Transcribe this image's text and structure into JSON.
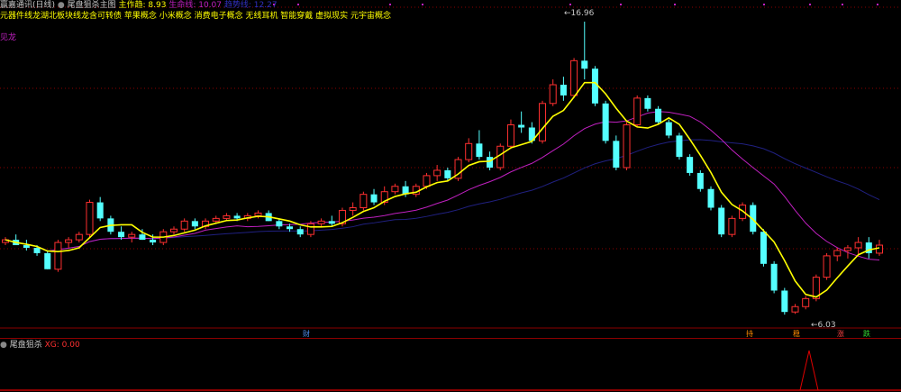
{
  "header": {
    "stock_name": "赢嘉通讯(日线)",
    "indicator_name": "尾盘狙杀主图",
    "ma_label": "主作趋: 8.93",
    "line2_label": "生命线: 10.07",
    "line3_label": "趋势线: 12.27"
  },
  "concepts_text": "元器件线龙湖北板块线龙含可转债 苹果概念 小米概念 消费电子概念 无线耳机 智能穿戴 虚拟现实 元宇宙概念",
  "side_label": "见龙",
  "price_high_label": "16.96",
  "price_low_label": "6.03",
  "bottom_markers": [
    {
      "text": "财",
      "color": "#4f8ff0"
    },
    {
      "text": "持",
      "color": "#ff8c00"
    },
    {
      "text": "稳",
      "color": "#ff8c00"
    },
    {
      "text": "涨",
      "color": "#ff4444"
    },
    {
      "text": "跌",
      "color": "#33dd33"
    }
  ],
  "sub_panel": {
    "title": "尾盘狙杀",
    "value_label": "XG: 0.00"
  },
  "colors": {
    "up": "#ff3030",
    "down": "#54ffff",
    "ma_yellow": "#ffff00",
    "ma_purple": "#c020c0",
    "ma_navy": "#202080",
    "dotted_grid": "#9a0000"
  },
  "chart_data": {
    "type": "candlestick",
    "ylim": [
      5.5,
      17.5
    ],
    "candles": [
      [
        8.7,
        8.9,
        8.6,
        8.8
      ],
      [
        8.8,
        9.0,
        8.7,
        8.6
      ],
      [
        8.6,
        8.8,
        8.4,
        8.5
      ],
      [
        8.5,
        8.6,
        8.2,
        8.3
      ],
      [
        8.3,
        8.4,
        7.7,
        7.7
      ],
      [
        7.7,
        8.8,
        7.6,
        8.7
      ],
      [
        8.7,
        8.9,
        8.5,
        8.8
      ],
      [
        8.8,
        9.1,
        8.7,
        9.0
      ],
      [
        9.0,
        10.3,
        8.9,
        10.2
      ],
      [
        10.2,
        10.4,
        9.5,
        9.6
      ],
      [
        9.6,
        9.7,
        9.0,
        9.1
      ],
      [
        9.1,
        9.3,
        8.8,
        8.9
      ],
      [
        8.9,
        9.1,
        8.7,
        9.0
      ],
      [
        9.0,
        9.2,
        8.8,
        8.8
      ],
      [
        8.8,
        9.0,
        8.6,
        8.7
      ],
      [
        8.7,
        9.2,
        8.6,
        9.1
      ],
      [
        9.1,
        9.3,
        9.0,
        9.2
      ],
      [
        9.2,
        9.6,
        9.1,
        9.5
      ],
      [
        9.5,
        9.6,
        9.2,
        9.3
      ],
      [
        9.3,
        9.6,
        9.2,
        9.5
      ],
      [
        9.5,
        9.7,
        9.4,
        9.6
      ],
      [
        9.6,
        9.8,
        9.5,
        9.7
      ],
      [
        9.7,
        9.8,
        9.5,
        9.6
      ],
      [
        9.6,
        9.8,
        9.5,
        9.7
      ],
      [
        9.7,
        9.9,
        9.6,
        9.8
      ],
      [
        9.8,
        9.9,
        9.5,
        9.5
      ],
      [
        9.5,
        9.6,
        9.2,
        9.3
      ],
      [
        9.3,
        9.4,
        9.1,
        9.2
      ],
      [
        9.2,
        9.3,
        8.9,
        9.0
      ],
      [
        9.0,
        9.5,
        8.9,
        9.4
      ],
      [
        9.4,
        9.6,
        9.3,
        9.5
      ],
      [
        9.5,
        9.7,
        9.3,
        9.4
      ],
      [
        9.4,
        10.0,
        9.3,
        9.9
      ],
      [
        9.9,
        10.2,
        9.7,
        10.0
      ],
      [
        10.0,
        10.6,
        9.9,
        10.5
      ],
      [
        10.5,
        10.7,
        10.1,
        10.2
      ],
      [
        10.2,
        10.8,
        10.1,
        10.6
      ],
      [
        10.6,
        10.9,
        10.5,
        10.8
      ],
      [
        10.8,
        11.0,
        10.4,
        10.5
      ],
      [
        10.5,
        10.9,
        10.4,
        10.8
      ],
      [
        10.8,
        11.3,
        10.7,
        11.2
      ],
      [
        11.2,
        11.6,
        11.0,
        11.4
      ],
      [
        11.4,
        11.5,
        11.0,
        11.1
      ],
      [
        11.1,
        11.9,
        11.0,
        11.8
      ],
      [
        11.8,
        12.6,
        11.7,
        12.4
      ],
      [
        12.4,
        12.9,
        11.8,
        11.9
      ],
      [
        11.9,
        12.1,
        11.4,
        11.5
      ],
      [
        11.5,
        12.4,
        11.4,
        12.3
      ],
      [
        12.3,
        13.3,
        12.2,
        13.1
      ],
      [
        13.1,
        13.6,
        12.8,
        13.0
      ],
      [
        13.0,
        13.2,
        12.4,
        12.5
      ],
      [
        12.5,
        14.0,
        12.4,
        13.9
      ],
      [
        13.9,
        14.8,
        13.8,
        14.6
      ],
      [
        14.6,
        14.9,
        14.0,
        14.2
      ],
      [
        14.2,
        15.6,
        14.1,
        15.5
      ],
      [
        15.5,
        16.96,
        14.8,
        15.2
      ],
      [
        15.2,
        15.3,
        13.8,
        13.9
      ],
      [
        13.9,
        14.0,
        12.4,
        12.5
      ],
      [
        12.5,
        12.7,
        11.4,
        11.5
      ],
      [
        11.5,
        13.2,
        11.4,
        13.1
      ],
      [
        13.1,
        14.2,
        13.0,
        14.1
      ],
      [
        14.1,
        14.2,
        13.6,
        13.7
      ],
      [
        13.7,
        13.8,
        13.1,
        13.2
      ],
      [
        13.2,
        13.3,
        12.6,
        12.7
      ],
      [
        12.7,
        12.8,
        11.8,
        11.9
      ],
      [
        11.9,
        12.0,
        11.2,
        11.3
      ],
      [
        11.3,
        11.4,
        10.6,
        10.7
      ],
      [
        10.7,
        10.8,
        9.9,
        10.0
      ],
      [
        10.0,
        10.1,
        8.9,
        9.0
      ],
      [
        9.0,
        9.7,
        8.9,
        9.6
      ],
      [
        9.6,
        10.2,
        9.5,
        10.1
      ],
      [
        10.1,
        10.2,
        9.0,
        9.1
      ],
      [
        9.1,
        9.2,
        7.8,
        7.9
      ],
      [
        7.9,
        8.0,
        6.8,
        6.9
      ],
      [
        6.9,
        7.0,
        6.0,
        6.1
      ],
      [
        6.1,
        6.4,
        6.03,
        6.3
      ],
      [
        6.3,
        6.7,
        6.2,
        6.6
      ],
      [
        6.6,
        7.5,
        6.5,
        7.4
      ],
      [
        7.4,
        8.3,
        7.3,
        8.2
      ],
      [
        8.2,
        8.5,
        8.0,
        8.4
      ],
      [
        8.4,
        8.6,
        8.1,
        8.5
      ],
      [
        8.5,
        8.9,
        8.2,
        8.7
      ],
      [
        8.7,
        8.9,
        8.1,
        8.3
      ],
      [
        8.3,
        8.8,
        8.2,
        8.6
      ]
    ]
  }
}
